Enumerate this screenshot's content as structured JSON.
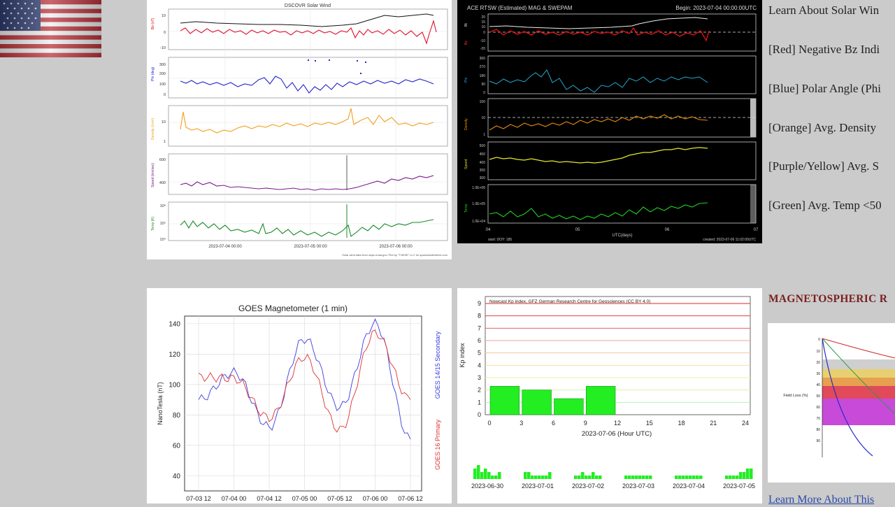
{
  "dscovr": {
    "title": "DSCOVR Solar Wind",
    "dates": [
      "2023-07-04 00:00",
      "2023-07-05 00:00",
      "2023-07-06 00:00"
    ],
    "credit": "Solar wind data from swpc.noaa.gov. Plot by \"T.WISE\" LLC for spaceweatherlive.com",
    "labels": [
      "Bz (nT)",
      "Phi (deg)",
      "Density (/cm³)",
      "Speed (km/sec)",
      "Temp (K)"
    ],
    "ticks": {
      "bz": [
        "10",
        "0",
        "-10"
      ],
      "phi": [
        "300",
        "200",
        "100",
        "0"
      ],
      "density": [
        "10",
        "1"
      ],
      "speed": [
        "600",
        "400"
      ],
      "temp": [
        "10⁶",
        "10⁵",
        "10⁴"
      ]
    }
  },
  "ace": {
    "title": "ACE RTSW (Estimated) MAG & SWEPAM",
    "begin": "Begin: 2023-07-04 00:00:00UTC",
    "xlabel": "UTC(days)",
    "xticks": [
      "04",
      "05",
      "06",
      "07"
    ],
    "start": "start: DOY: 185",
    "created": "created: 2023-07-06 11:02:00UTC",
    "labels": [
      "Bt",
      "Bz",
      "Phi",
      "Density",
      "Speed",
      "Temp"
    ],
    "ticks": {
      "bz": [
        "20",
        "15",
        "10",
        "0",
        "-10",
        "-20"
      ],
      "phi": [
        "360",
        "270",
        "180",
        "90",
        "0"
      ],
      "density": [
        "100",
        "10",
        "1"
      ],
      "speed": [
        "500",
        "450",
        "400",
        "350",
        "300"
      ],
      "temp": [
        "1.0E+06",
        "1.0E+05",
        "1.0E+04"
      ]
    }
  },
  "legend": {
    "learn": "Learn About Solar Win",
    "red": "[Red] Negative Bz Indi",
    "blue": "[Blue] Polar Angle (Phi",
    "orange": "[Orange] Avg. Density",
    "purple": "[Purple/Yellow] Avg. S",
    "green": "[Green] Avg. Temp <50"
  },
  "goes": {
    "title": "GOES Magnetometer (1 min)",
    "ylabel": "NanoTesla (nT)",
    "yticks": [
      "140",
      "120",
      "100",
      "80",
      "60",
      "40"
    ],
    "xticks": [
      "07-03 12",
      "07-04 00",
      "07-04 12",
      "07-05 00",
      "07-05 12",
      "07-06 00",
      "07-06 12"
    ],
    "secondary": "GOES 14/15 Secondary",
    "primary": "GOES 16 Primary"
  },
  "kp": {
    "title": "Nowcast Kp index, GFZ German Research Centre for Geosciences (CC BY 4.0)",
    "ylabel": "Kp index",
    "xlabel": "2023-07-06 (Hour UTC)",
    "yticks": [
      "9",
      "8",
      "7",
      "6",
      "5",
      "4",
      "3",
      "2",
      "1",
      "0"
    ],
    "xticks": [
      "0",
      "3",
      "6",
      "9",
      "12",
      "15",
      "18",
      "21",
      "24"
    ],
    "days": [
      "2023-06-30",
      "2023-07-01",
      "2023-07-02",
      "2023-07-03",
      "2023-07-04",
      "2023-07-05"
    ]
  },
  "magnetospheric": {
    "title": "MAGNETOSPHERIC R",
    "ylabel": "Field Loss (%)",
    "learn_more": "Learn More About This"
  },
  "chart_data": [
    {
      "type": "line",
      "title": "GOES Magnetometer (1 min)",
      "ylabel": "NanoTesla (nT)",
      "ylim": [
        30,
        145
      ],
      "x": [
        "07-03 12",
        "07-04 00",
        "07-04 12",
        "07-05 00",
        "07-05 12",
        "07-06 00",
        "07-06 12"
      ],
      "series": [
        {
          "name": "GOES 14/15 Secondary",
          "values": [
            90,
            108,
            72,
            130,
            85,
            140,
            64
          ]
        },
        {
          "name": "GOES 16 Primary",
          "values": [
            105,
            104,
            78,
            118,
            70,
            134,
            90
          ]
        }
      ]
    },
    {
      "type": "bar",
      "title": "Nowcast Kp index, GFZ German Research Centre for Geosciences (CC BY 4.0)",
      "xlabel": "2023-07-06 (Hour UTC)",
      "ylabel": "Kp index",
      "categories": [
        "0",
        "3",
        "6",
        "9"
      ],
      "values": [
        2.3,
        2.0,
        1.3,
        2.3
      ],
      "ylim": [
        0,
        9
      ]
    }
  ]
}
